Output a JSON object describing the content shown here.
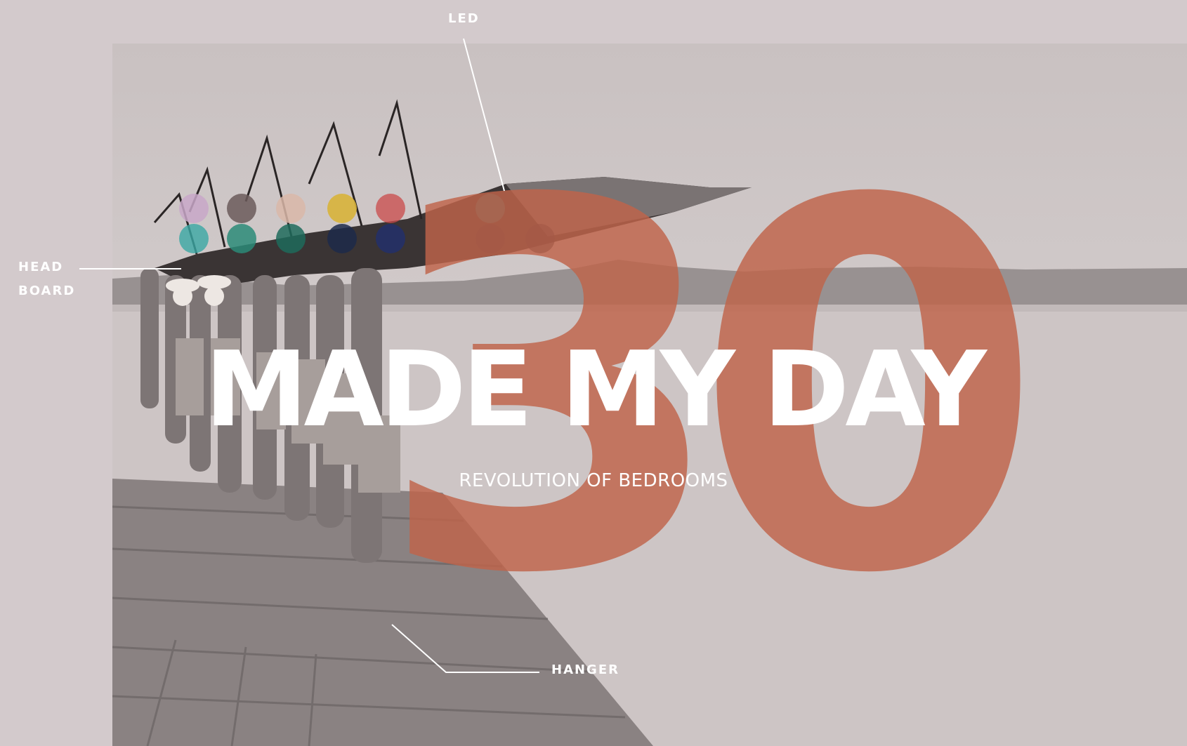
{
  "hero": {
    "number": "30",
    "title": "MADE MY DAY",
    "subtitle": "REVOLUTION OF BEDROOMS"
  },
  "annotations": {
    "led": "LED",
    "head": "HEAD",
    "board": "BOARD",
    "hanger": "HANGER"
  },
  "colors": {
    "page_background": "#d3cacc",
    "number_accent": "#c0644a",
    "text": "#ffffff",
    "led_palette": [
      "#c8a7c8",
      "#6b5a5a",
      "#d9b7a8",
      "#d8b33a",
      "#c94a4a",
      "#2f7a7a",
      "#3aa7a4",
      "#2b8b78",
      "#1e6b5c",
      "#1d2a4a",
      "#23306b",
      "#2a2a3a"
    ]
  }
}
